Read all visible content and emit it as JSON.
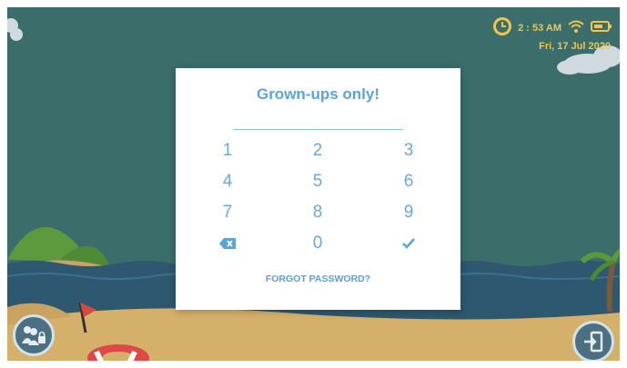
{
  "status": {
    "time": "2 : 53 AM",
    "date": "Fri, 17 Jul 2020",
    "icons": [
      "clock-icon",
      "wifi-icon",
      "battery-icon"
    ]
  },
  "dialog": {
    "title": "Grown-ups only!",
    "keypad": {
      "digits": [
        "1",
        "2",
        "3",
        "4",
        "5",
        "6",
        "7",
        "8",
        "9",
        "0"
      ],
      "backspace_icon": "backspace-icon",
      "confirm_icon": "check-icon"
    },
    "forgot_label": "FORGOT PASSWORD?"
  },
  "corner_buttons": {
    "left_icon": "parent-lock-icon",
    "right_icon": "exit-icon"
  },
  "colors": {
    "sky": "#3b6d6b",
    "sea": "#2d5870",
    "sand": "#d5b06a",
    "accent": "#5aa4d8",
    "status": "#f1c44e"
  }
}
